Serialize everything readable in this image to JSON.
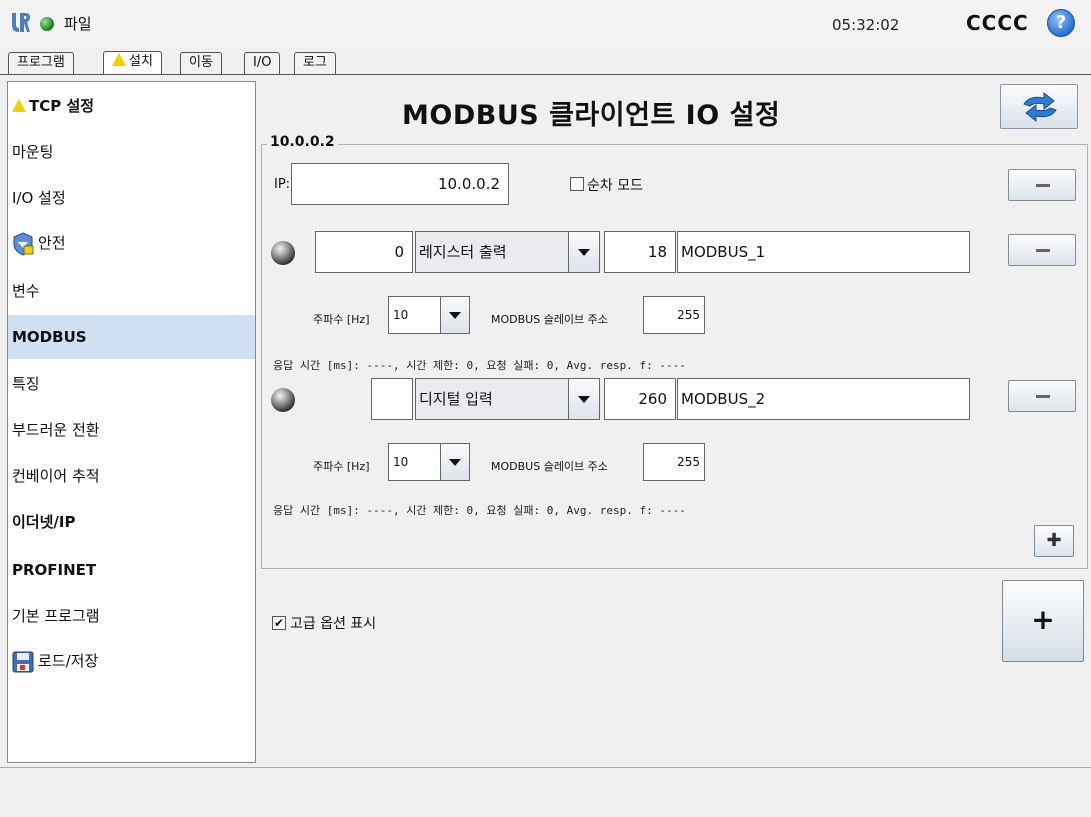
{
  "topbar": {
    "file_menu": "파일",
    "time": "05:32:02",
    "robot_name": "CCCC",
    "help": "?"
  },
  "tabs": [
    {
      "label": "프로그램",
      "active": false
    },
    {
      "label": "설치",
      "active": true,
      "warning": true
    },
    {
      "label": "이동",
      "active": false
    },
    {
      "label": "I/O",
      "active": false
    },
    {
      "label": "로그",
      "active": false
    }
  ],
  "sidebar": {
    "items": [
      {
        "label": "TCP 설정",
        "icon": "warning-icon"
      },
      {
        "label": "마운팅"
      },
      {
        "label": "I/O 설정"
      },
      {
        "label": "안전",
        "icon": "safety-shield-icon"
      },
      {
        "label": "변수"
      },
      {
        "label": "MODBUS",
        "selected": true
      },
      {
        "label": "특징"
      },
      {
        "label": "부드러운 전환"
      },
      {
        "label": "컨베이어 추적"
      },
      {
        "label": "이더넷/IP"
      },
      {
        "label": "PROFINET"
      },
      {
        "label": "기본 프로그램"
      },
      {
        "label": "로드/저장",
        "icon": "floppy-disk-icon"
      }
    ]
  },
  "main": {
    "title": "MODBUS 클라이언트 IO 설정",
    "client": {
      "legend": "10.0.0.2",
      "ip_label": "IP:",
      "ip_value": "10.0.0.2",
      "sequential_label": "순차 모드",
      "sequential_checked": false,
      "signals": [
        {
          "address": "0",
          "type": "레지스터 출력",
          "register": "18",
          "name": "MODBUS_1",
          "freq_label": "주파수 [Hz]",
          "freq_value": "10",
          "slave_label": "MODBUS 슬레이브 주소",
          "slave_value": "255",
          "stats": "응답 시간 [ms]: ----, 시간 제한: 0, 요청 실패: 0, Avg. resp. f: ----"
        },
        {
          "address": "",
          "type": "디지털 입력",
          "register": "260",
          "name": "MODBUS_2",
          "freq_label": "주파수 [Hz]",
          "freq_value": "10",
          "slave_label": "MODBUS 슬레이브 주소",
          "slave_value": "255",
          "stats": "응답 시간 [ms]: ----, 시간 제한: 0, 요청 실패: 0, Avg. resp. f: ----"
        }
      ]
    },
    "advanced_label": "고급 옵션 표시",
    "advanced_checked": true,
    "add_signal": "✚",
    "add_client": "+"
  },
  "colors": {
    "selected_nav": "#cfe0f2",
    "status_green": "#1f8a1f"
  }
}
